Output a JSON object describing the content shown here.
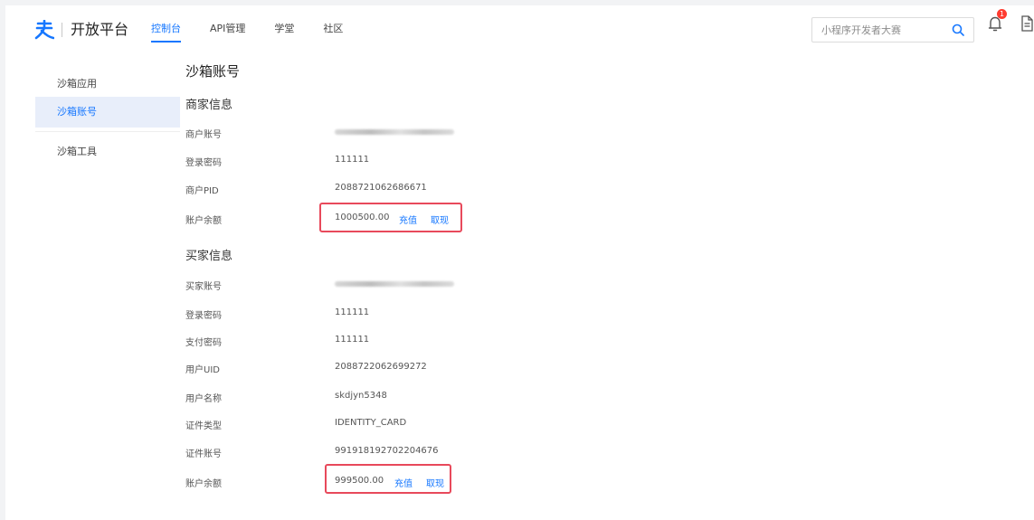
{
  "header": {
    "brand": "开放平台",
    "nav": [
      "控制台",
      "API管理",
      "学堂",
      "社区"
    ],
    "search_placeholder": "小程序开发者大赛",
    "notification_count": "1",
    "colors": {
      "accent": "#1677ff",
      "highlight": "#e8495b"
    }
  },
  "sidebar": {
    "items": [
      "沙箱应用",
      "沙箱账号",
      "沙箱工具"
    ]
  },
  "main": {
    "title": "沙箱账号",
    "merchant": {
      "title": "商家信息",
      "account_label": "商户账号",
      "password_label": "登录密码",
      "password_value": "111111",
      "pid_label": "商户PID",
      "pid_value": "2088721062686671",
      "balance_label": "账户余额",
      "balance_value": "1000500.00",
      "recharge": "充值",
      "withdraw": "取现"
    },
    "buyer": {
      "title": "买家信息",
      "account_label": "买家账号",
      "login_password_label": "登录密码",
      "login_password_value": "111111",
      "pay_password_label": "支付密码",
      "pay_password_value": "111111",
      "uid_label": "用户UID",
      "uid_value": "2088722062699272",
      "name_label": "用户名称",
      "name_value": "skdjyn5348",
      "cert_type_label": "证件类型",
      "cert_type_value": "IDENTITY_CARD",
      "cert_no_label": "证件账号",
      "cert_no_value": "991918192702204676",
      "balance_label": "账户余额",
      "balance_value": "999500.00",
      "recharge": "充值",
      "withdraw": "取现"
    }
  }
}
